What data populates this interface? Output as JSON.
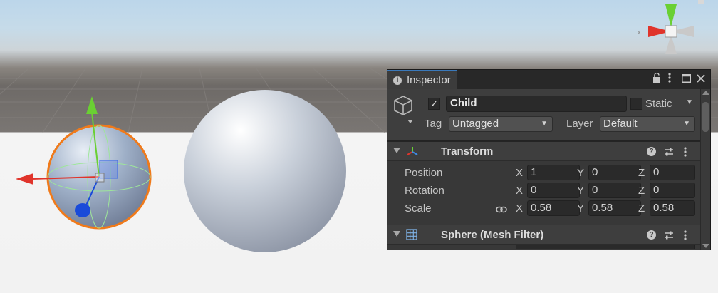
{
  "inspector": {
    "tab_label": "Inspector",
    "object_name": "Child",
    "active_checked": true,
    "static_label": "Static",
    "static_checked": false,
    "tag_label": "Tag",
    "tag_value": "Untagged",
    "layer_label": "Layer",
    "layer_value": "Default"
  },
  "transform": {
    "title": "Transform",
    "rows": [
      {
        "label": "Position",
        "x": "1",
        "y": "0",
        "z": "0"
      },
      {
        "label": "Rotation",
        "x": "0",
        "y": "0",
        "z": "0"
      },
      {
        "label": "Scale",
        "x": "0.58",
        "y": "0.58",
        "z": "0.58"
      }
    ],
    "axis_x": "X",
    "axis_y": "Y",
    "axis_z": "Z"
  },
  "mesh_filter": {
    "title": "Sphere (Mesh Filter)"
  },
  "scene_gizmo": {
    "x_label": "x"
  },
  "icons": [
    "info-icon",
    "lock-icon",
    "kebab-menu-icon",
    "maximize-icon",
    "close-icon",
    "gameobject-cube-icon",
    "transform-axes-icon",
    "mesh-grid-icon",
    "help-icon",
    "presets-icon",
    "link-scale-icon"
  ],
  "colors": {
    "panel_bg": "#383838",
    "tab_accent": "#3a79bb",
    "gizmo_x": "#e0342b",
    "gizmo_y": "#6ad033",
    "gizmo_z": "#1a4bd9",
    "selection_outline": "#f07a1a"
  }
}
